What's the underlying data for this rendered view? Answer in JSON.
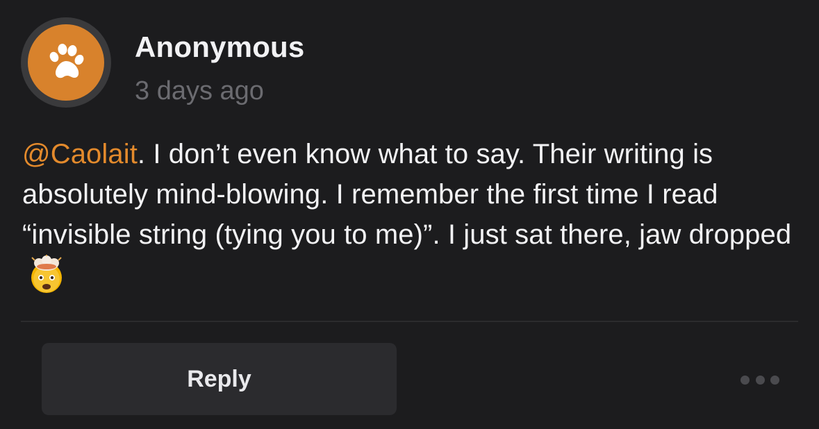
{
  "comment": {
    "author": "Anonymous",
    "timestamp": "3 days ago",
    "avatar_icon": "paw-icon",
    "avatar_color": "#d8822c",
    "mention": "@Caolait",
    "text": ". I don’t even know what to say. Their writing is absolutely mind-blowing. I remember the first time I read “invisible string (tying you to me)”. I just sat there, jaw dropped",
    "emoji_icon": "exploding-head-emoji",
    "mention_color": "#e38a2c"
  },
  "actions": {
    "reply_label": "Reply",
    "more_icon": "more-options-icon"
  }
}
